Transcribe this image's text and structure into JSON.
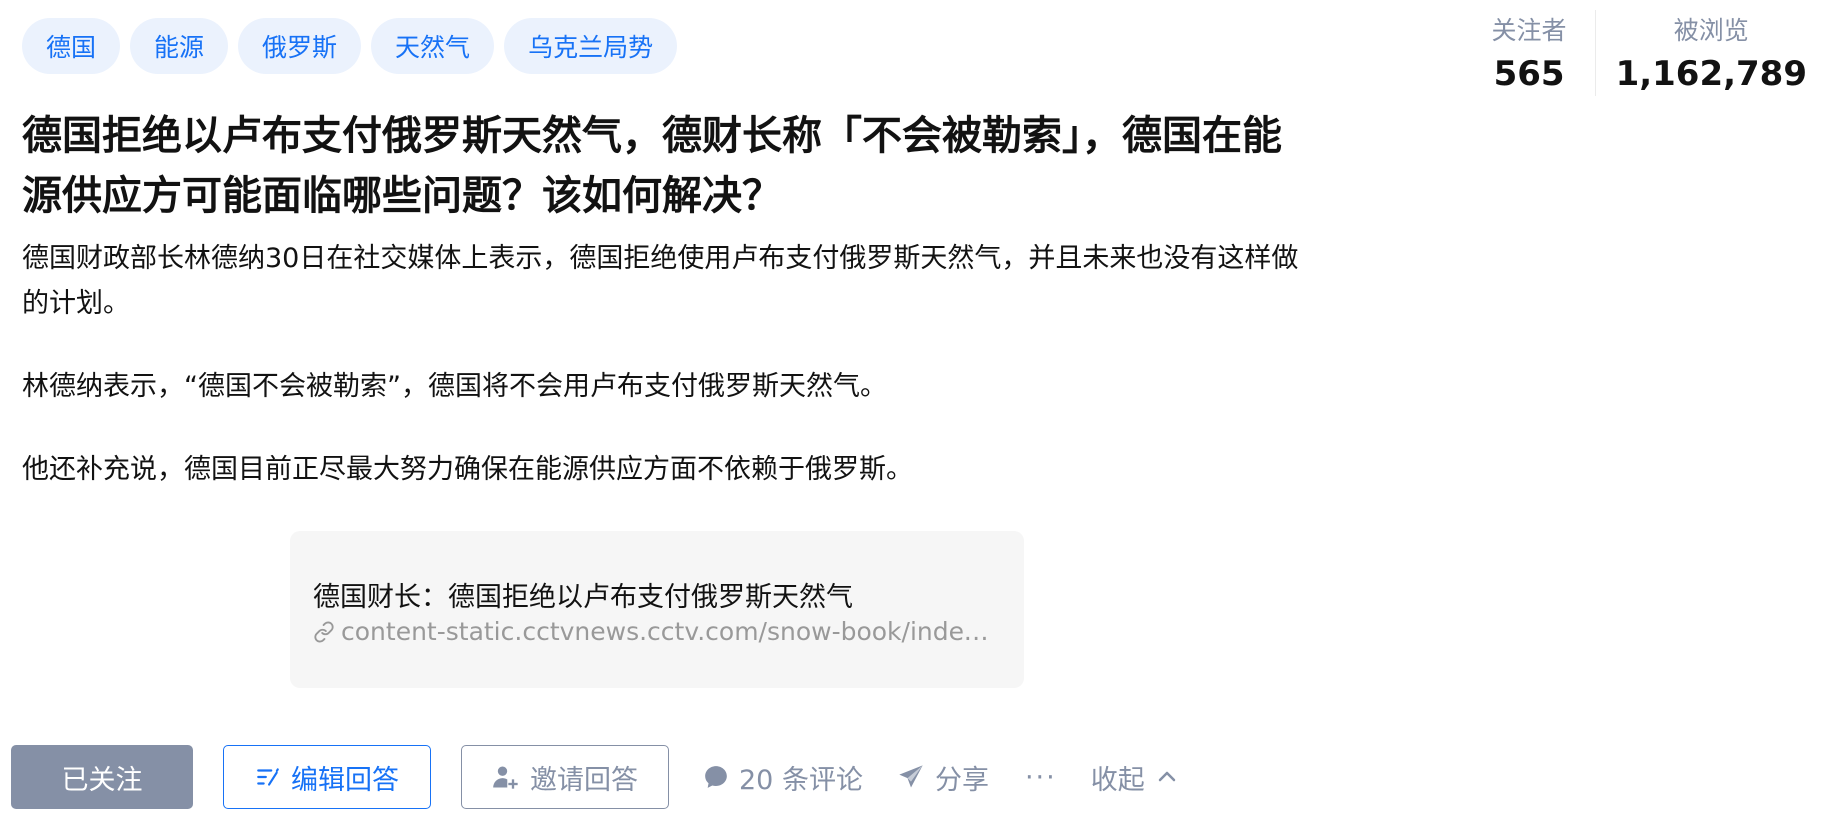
{
  "tags": [
    "德国",
    "能源",
    "俄罗斯",
    "天然气",
    "乌克兰局势"
  ],
  "stats": {
    "followers_label": "关注者",
    "followers_value": "565",
    "views_label": "被浏览",
    "views_value": "1,162,789"
  },
  "question": {
    "title": "德国拒绝以卢布支付俄罗斯天然气，德财长称「不会被勒索」，德国在能源供应方可能面临哪些问题？该如何解决？",
    "paragraphs": [
      "德国财政部长林德纳30日在社交媒体上表示，德国拒绝使用卢布支付俄罗斯天然气，并且未来也没有这样做的计划。",
      "林德纳表示，“德国不会被勒索”，德国将不会用卢布支付俄罗斯天然气。",
      "他还补充说，德国目前正尽最大努力确保在能源供应方面不依赖于俄罗斯。"
    ]
  },
  "link_card": {
    "title": "德国财长：德国拒绝以卢布支付俄罗斯天然气",
    "url": "content-static.cctvnews.cctv.com/snow-book/index.html"
  },
  "actions": {
    "followed": "已关注",
    "edit_answer": "编辑回答",
    "invite_answer": "邀请回答",
    "comments": "20 条评论",
    "share": "分享",
    "more": "···",
    "collapse": "收起"
  },
  "colors": {
    "accent": "#1772f6",
    "tag_bg": "#ebf2fd",
    "muted": "#8590a6"
  }
}
